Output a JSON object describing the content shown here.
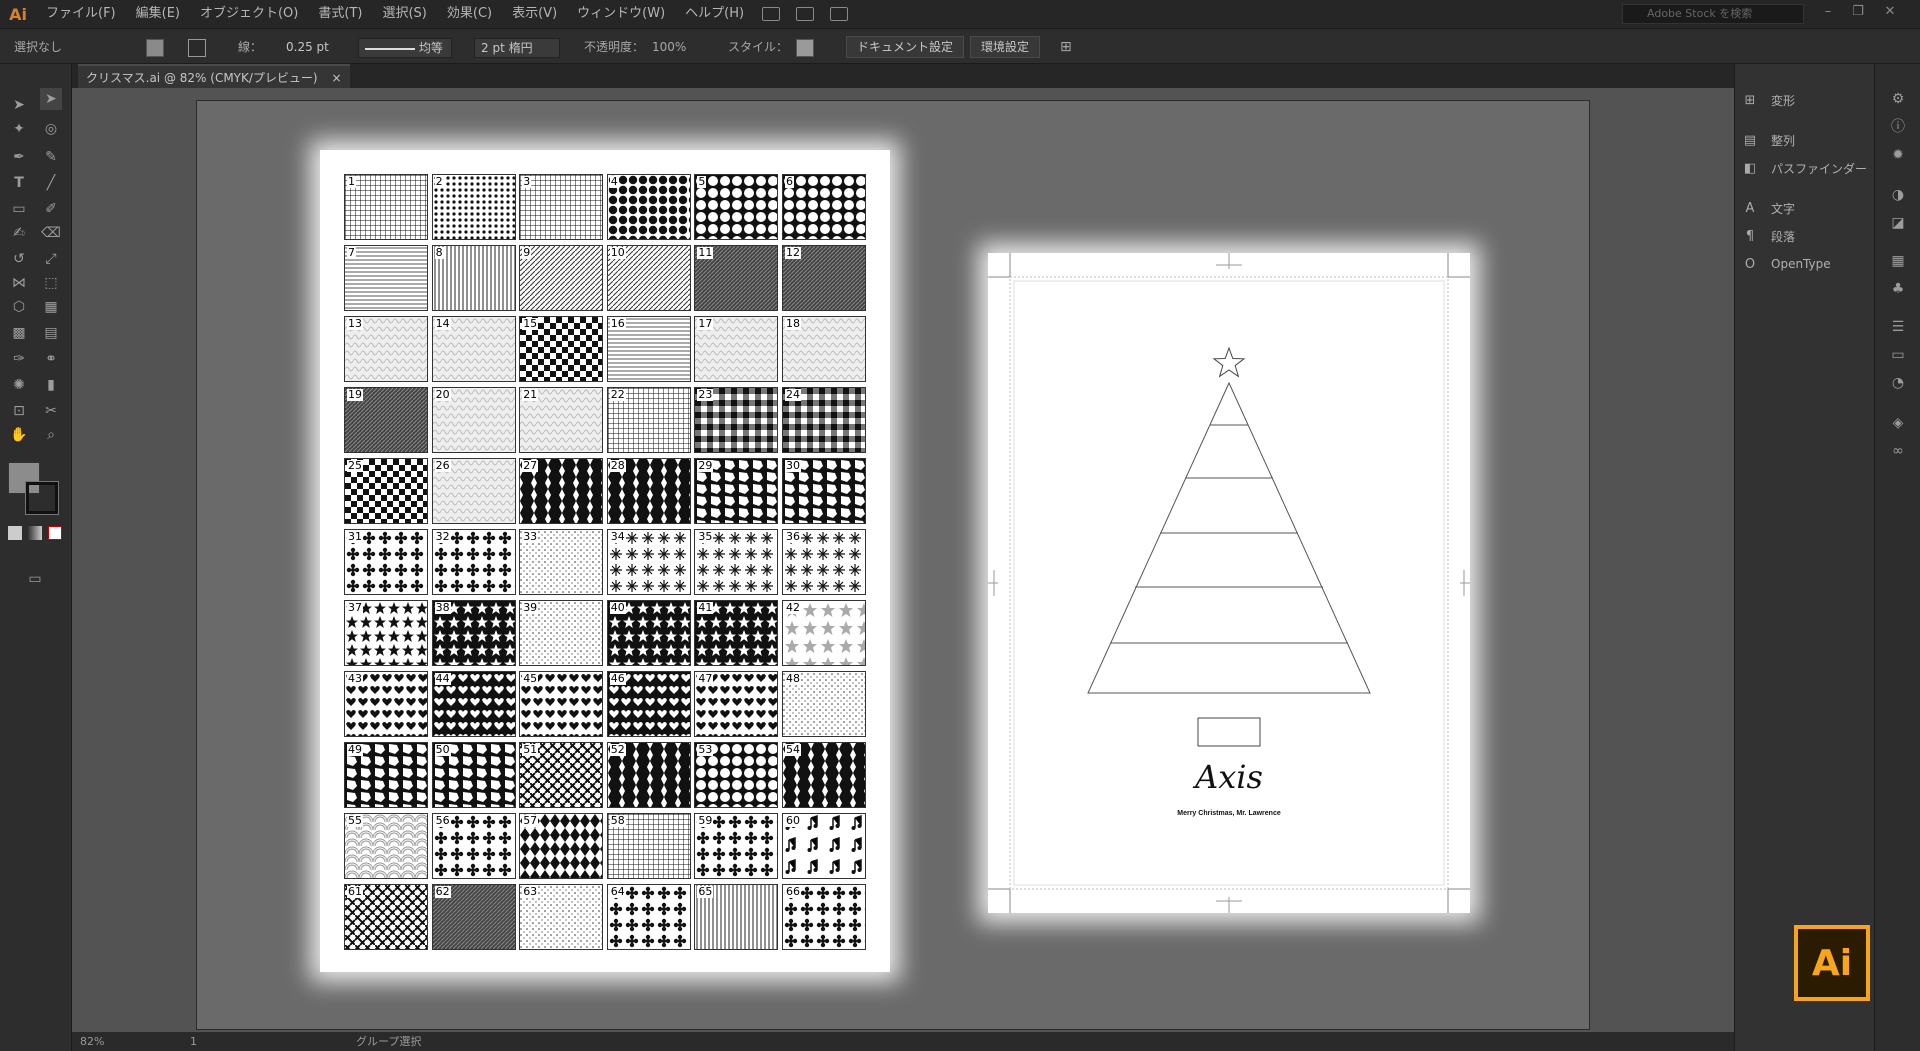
{
  "app": {
    "logo": "Ai",
    "menu": [
      "ファイル(F)",
      "編集(E)",
      "オブジェクト(O)",
      "書式(T)",
      "選択(S)",
      "効果(C)",
      "表示(V)",
      "ウィンドウ(W)",
      "ヘルプ(H)"
    ],
    "search_placeholder": "Adobe Stock を検索",
    "window_controls": [
      "–",
      "❐",
      "✕"
    ]
  },
  "controlbar": {
    "selection": "選択なし",
    "stroke_label": "線：",
    "stroke_weight": "0.25 pt",
    "stroke_profile": "均等",
    "brush": "2 pt 楕円",
    "opacity_label": "不透明度：",
    "opacity": "100%",
    "style_label": "スタイル：",
    "doc_setup": "ドキュメント設定",
    "prefs": "環境設定"
  },
  "document": {
    "tab_title": "クリスマス.ai @ 82% (CMYK/プレビュー)",
    "tab_close": "×"
  },
  "patterns": [
    "1",
    "2",
    "3",
    "4",
    "5",
    "6",
    "7",
    "8",
    "9",
    "10",
    "11",
    "12",
    "13",
    "14",
    "15",
    "16",
    "17",
    "18",
    "19",
    "20",
    "21",
    "22",
    "23",
    "24",
    "25",
    "26",
    "27",
    "28",
    "29",
    "30",
    "31",
    "32",
    "33",
    "34",
    "35",
    "36",
    "37",
    "38",
    "39",
    "40",
    "41",
    "42",
    "43",
    "44",
    "45",
    "46",
    "47",
    "48",
    "49",
    "50",
    "51",
    "52",
    "53",
    "54",
    "55",
    "56",
    "57",
    "58",
    "59",
    "60",
    "61",
    "62",
    "63",
    "64",
    "65",
    "66"
  ],
  "card": {
    "logo_text": "Axis",
    "caption": "Merry Christmas, Mr. Lawrence"
  },
  "panels": [
    {
      "icon": "transform-icon",
      "label": "変形"
    },
    {
      "icon": "align-icon",
      "label": "整列"
    },
    {
      "icon": "pathfinder-icon",
      "label": "パスファインダー"
    },
    {
      "icon": "character-icon",
      "label": "文字"
    },
    {
      "icon": "paragraph-icon",
      "label": "段落"
    },
    {
      "icon": "opentype-icon",
      "label": "OpenType"
    }
  ],
  "status": {
    "zoom": "82%",
    "artboard": "1",
    "tool": "グループ選択"
  },
  "badge": "Ai"
}
